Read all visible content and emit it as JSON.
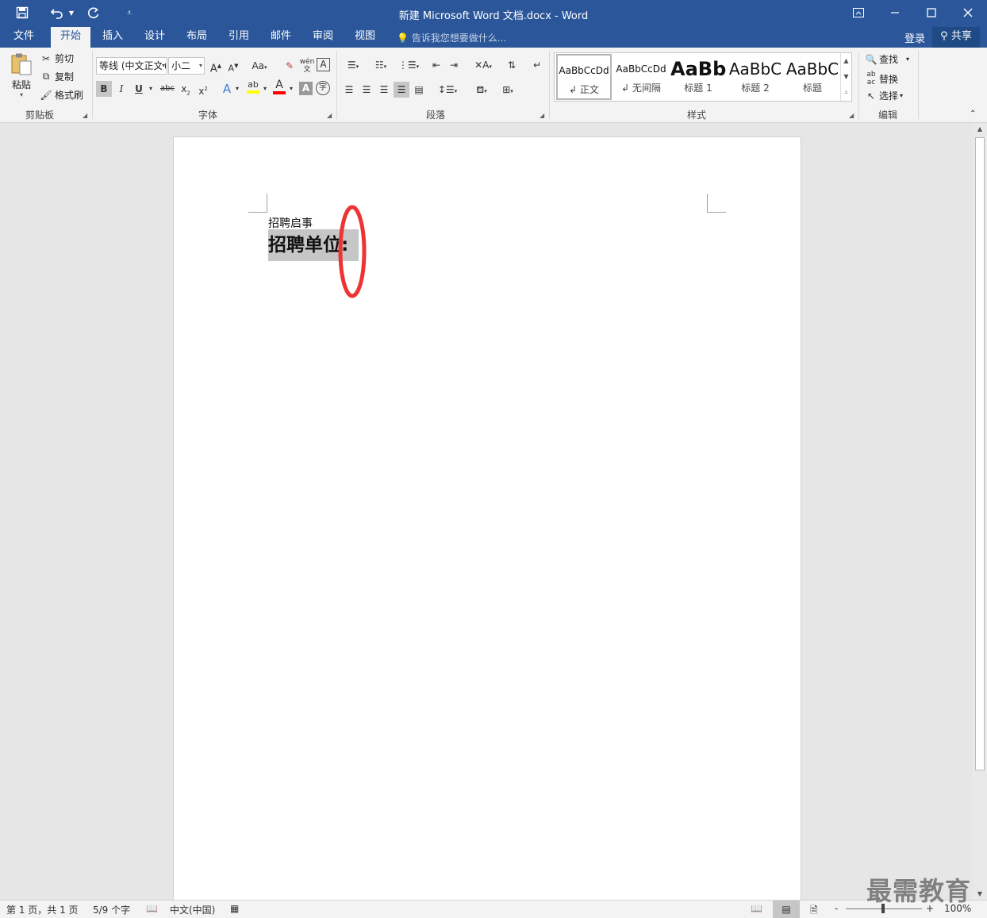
{
  "window": {
    "title": "新建 Microsoft Word 文档.docx - Word",
    "save_icon": "save-icon",
    "undo_icon": "undo-icon",
    "redo_icon": "redo-icon",
    "customize_icon": "customize-qat-icon",
    "restore_ribbon_icon": "ribbon-display-icon",
    "minimize_icon": "minimize-icon",
    "maximize_icon": "maximize-icon",
    "close_icon": "close-icon"
  },
  "tabs": [
    {
      "label": "文件"
    },
    {
      "label": "开始",
      "active": true
    },
    {
      "label": "插入"
    },
    {
      "label": "设计"
    },
    {
      "label": "布局"
    },
    {
      "label": "引用"
    },
    {
      "label": "邮件"
    },
    {
      "label": "审阅"
    },
    {
      "label": "视图"
    }
  ],
  "tellme": "告诉我您想要做什么...",
  "login": "登录",
  "share": "共享",
  "clipboard": {
    "group": "剪贴板",
    "paste": "粘贴",
    "cut": "剪切",
    "copy": "复制",
    "format_painter": "格式刷"
  },
  "font": {
    "group": "字体",
    "family": "等线 (中文正文)",
    "size": "小二",
    "grow": "A",
    "shrink": "A",
    "change_case": "Aa",
    "bold": "B",
    "italic": "I",
    "underline": "U",
    "strikethrough": "abc",
    "subscript": "x",
    "superscript": "x",
    "text_effects": "A",
    "highlight": "ab",
    "font_color": "A",
    "char_shading": "A",
    "enclose": "字",
    "phonetic": "wén",
    "char_border": "A",
    "highlight_color": "#ffff00",
    "font_color_value": "#ff0000"
  },
  "paragraph": {
    "group": "段落"
  },
  "styles": {
    "group": "样式",
    "items": [
      {
        "preview": "AaBbCcDd",
        "name": "正文"
      },
      {
        "preview": "AaBbCcDd",
        "name": "无间隔"
      },
      {
        "preview": "AaBb",
        "name": "标题 1"
      },
      {
        "preview": "AaBbC",
        "name": "标题 2"
      },
      {
        "preview": "AaBbC",
        "name": "标题"
      }
    ]
  },
  "editing": {
    "group": "编辑",
    "find": "查找",
    "replace": "替换",
    "select": "选择"
  },
  "document": {
    "line1": "招聘启事",
    "line2": "招聘单位:"
  },
  "status": {
    "page": "第 1 页，共 1 页",
    "words": "5/9 个字",
    "language": "中文(中国)",
    "zoom_minus": "-",
    "zoom_plus": "+",
    "zoom": "100%"
  },
  "watermark": "最需教育",
  "accent": "#2b579a",
  "annotation_color": "#ee3333"
}
